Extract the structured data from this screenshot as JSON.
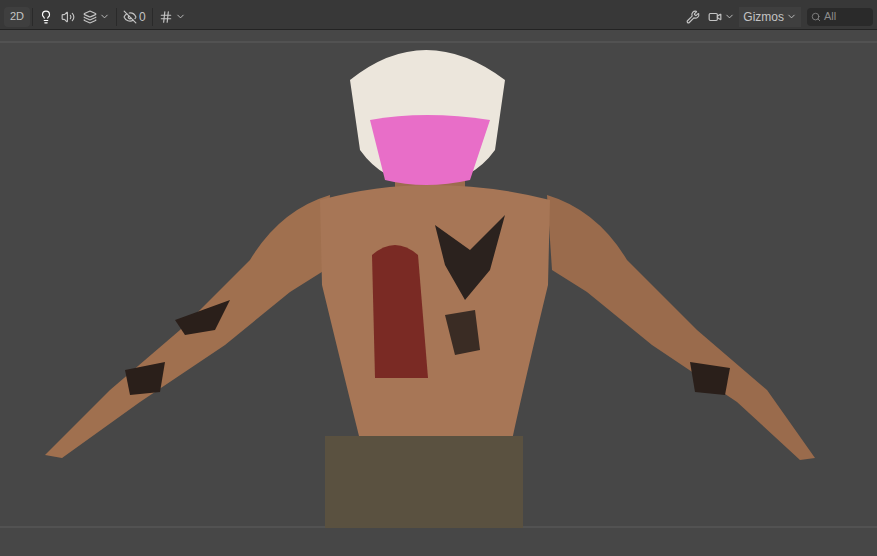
{
  "toolbar": {
    "view_2d": {
      "label": "2D",
      "selected": false
    },
    "scene_lighting": {
      "on": true
    },
    "scene_audio": {
      "on": false
    },
    "hidden_objects": {
      "count": "0"
    },
    "gizmos": {
      "label": "Gizmos"
    },
    "search": {
      "placeholder": "All"
    }
  }
}
